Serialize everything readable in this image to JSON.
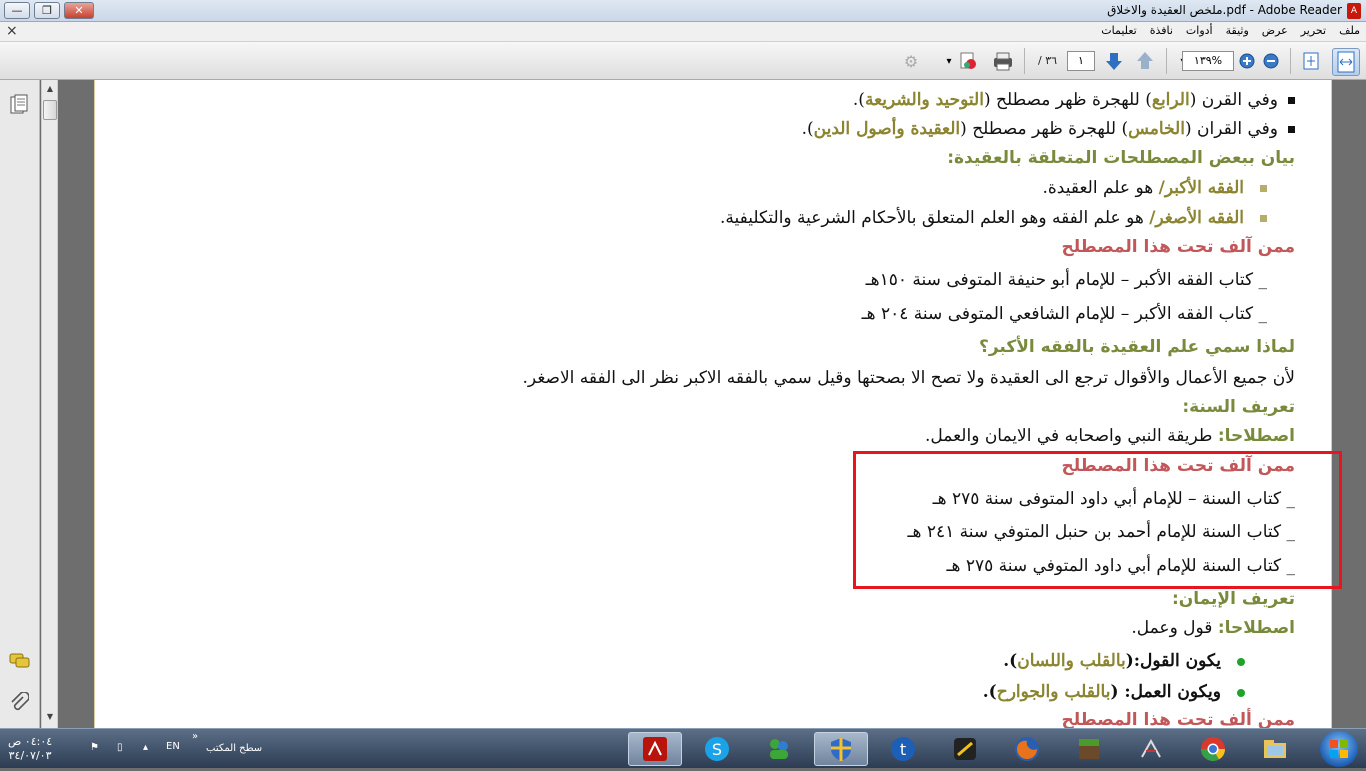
{
  "window": {
    "title": "pdf - Adobe Reader.ملخص العقيدة والاخلاق",
    "controls": {
      "minimize": "—",
      "restore": "❐",
      "close": "✕"
    }
  },
  "menu": {
    "items": [
      "ملف",
      "تحرير",
      "عرض",
      "وثيقة",
      "أدوات",
      "نافذة",
      "تعليمات"
    ],
    "close_symbol": "×"
  },
  "toolbar": {
    "page_current": "١",
    "page_total": "/ ٣٦",
    "zoom": "١٣٩%"
  },
  "document": {
    "lines": [
      {
        "pre": "وفي القرن (",
        "hl": "الرابع",
        "mid": ")  للهجرة ظهر مصطلح (",
        "hl2": "التوحيد والشريعة",
        "post": ")."
      },
      {
        "pre": "وفي القران (",
        "hl": "الخامس",
        "mid": ") للهجرة ظهر مصطلح (",
        "hl2": "العقيدة وأصول الدين",
        "post": ")."
      },
      {
        "text": "بيان ببعض المصطلحات المتعلقة بالعقيدة:"
      },
      {
        "hl": "الفقه الأكبر/",
        "post": " هو علم العقيدة."
      },
      {
        "hl": "الفقه الأصغر/",
        "post": " هو علم الفقه وهو العلم المتعلق بالأحكام الشرعية والتكليفية."
      },
      {
        "text": "ممن آلف تحت هذا المصطلح"
      },
      {
        "text": "_ كتاب الفقه الأكبر – للإمام أبو حنيفة المتوفى سنة ١٥٠هـ"
      },
      {
        "text": "_ كتاب الفقه الأكبر – للإمام الشافعي المتوفى سنة ٢٠٤ هـ"
      },
      {
        "text": "لماذا سمي علم العقيدة بالفقه الأكبر؟"
      },
      {
        "text": "لأن جميع الأعمال والأقوال ترجع الى العقيدة ولا تصح الا بصحتها وقيل سمي بالفقه الاكبر نظر الى الفقه الاصغر."
      },
      {
        "text": "تعريف السنة:"
      },
      {
        "hl": "اصطلاحا:",
        "post": " طريقة النبي واصحابه في الايمان والعمل."
      },
      {
        "text": "ممن آلف تحت هذا المصطلح"
      },
      {
        "text": "_ كتاب السنة – للإمام أبي داود المتوفى سنة ٢٧٥ هـ"
      },
      {
        "text": "_ كتاب السنة للإمام أحمد بن حنبل المتوفي سنة ٢٤١ هـ"
      },
      {
        "text": "_ كتاب السنة للإمام أبي داود المتوفي سنة ٢٧٥ هـ"
      },
      {
        "text": "تعريف الإيمان:"
      },
      {
        "hl": "اصطلاحا:",
        "post": " قول وعمل."
      },
      {
        "pre": "يكون القول:(",
        "hl": "بالقلب واللسان",
        "post": ")."
      },
      {
        "pre": "ويكون العمل: (",
        "hl": "بالقلب والجوارح",
        "post": ")."
      },
      {
        "text": "ممن ألف تحت هذا المصطلح"
      }
    ]
  },
  "taskbar": {
    "desktop_label": "سطح المكتب",
    "lang": "EN",
    "time": "٠٤:٠٤ ص",
    "date": "٣٤/٠٧/٠٣"
  },
  "colors": {
    "heading_green": "#7a8a3c",
    "heading_red": "#c2575a",
    "term_gold": "#8b8430",
    "highlight_box": "#e8141e"
  }
}
